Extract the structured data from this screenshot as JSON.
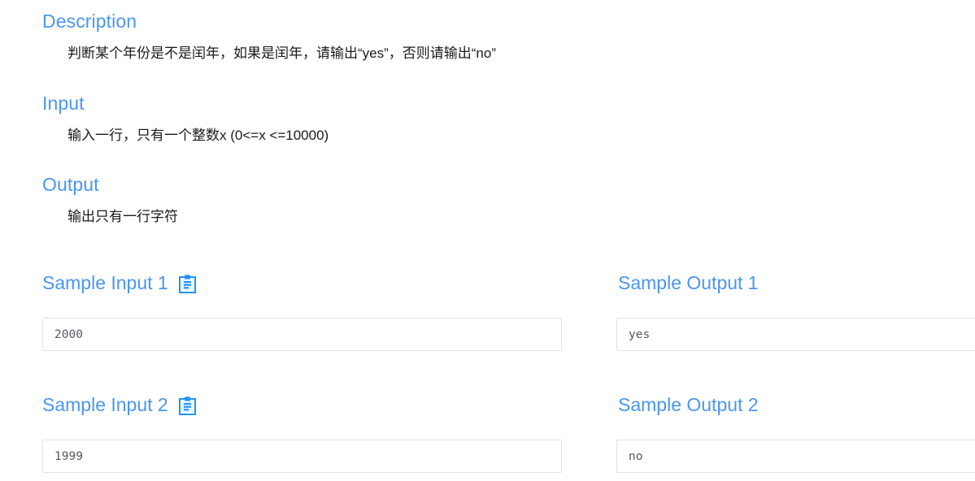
{
  "sections": [
    {
      "heading": "Description",
      "body": "判断某个年份是不是闰年，如果是闰年，请输出“yes”，否则请输出“no”"
    },
    {
      "heading": "Input",
      "body": "输入一行，只有一个整数x (0<=x <=10000)"
    },
    {
      "heading": "Output",
      "body": "输出只有一行字符"
    }
  ],
  "samples": [
    {
      "input_heading": "Sample Input 1",
      "input_value": "2000",
      "input_copy_icon": "clipboard-copy-icon",
      "output_heading": "Sample Output 1",
      "output_value": "yes"
    },
    {
      "input_heading": "Sample Input 2",
      "input_value": "1999",
      "input_copy_icon": "clipboard-copy-icon",
      "output_heading": "Sample Output 2",
      "output_value": "no"
    }
  ],
  "colors": {
    "heading_blue": "#4a96f0",
    "body_text": "#1a1a1a",
    "box_border": "#e3e3e3",
    "box_text": "#555a60",
    "background": "#ffffff"
  }
}
